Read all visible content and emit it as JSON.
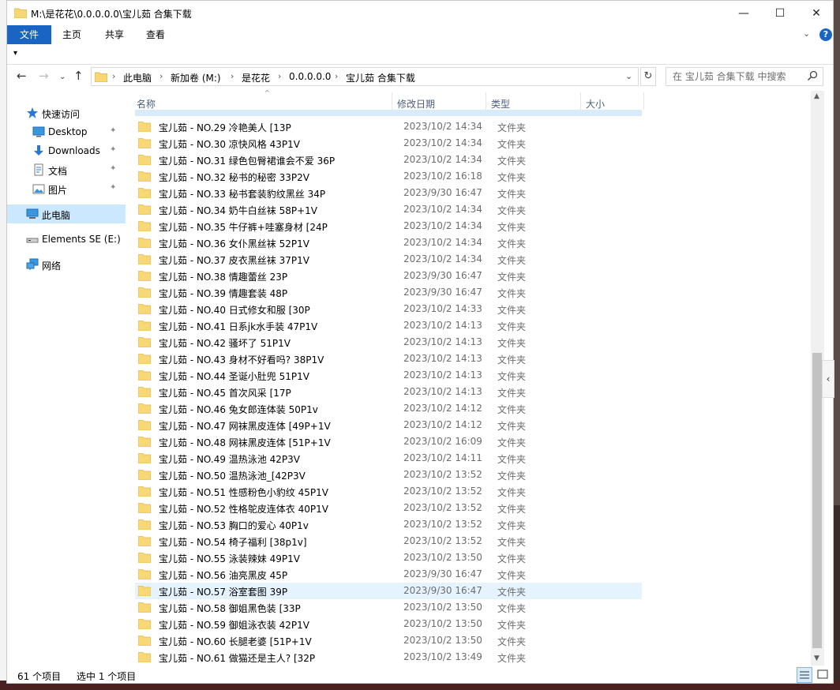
{
  "window": {
    "title": "M:\\是花花\\0.0.0.0.0\\宝儿茹 合集下载"
  },
  "controls": {
    "minimize": "—",
    "maximize": "☐",
    "close": "✕"
  },
  "ribbon": {
    "tabs": [
      "文件",
      "主页",
      "共享",
      "查看"
    ],
    "expand": "⌄",
    "help": "?"
  },
  "qat": {
    "arrow": "▾"
  },
  "nav": {
    "back": "←",
    "forward": "→",
    "recent": "⌄",
    "up": "↑"
  },
  "address": {
    "crumbs": [
      "此电脑",
      "新加卷 (M:)",
      "是花花",
      "0.0.0.0.0",
      "宝儿茹 合集下载"
    ],
    "separator": "›",
    "dropdown": "⌄",
    "refresh": "↻"
  },
  "search": {
    "placeholder": "在 宝儿茹 合集下载 中搜索",
    "icon": "search-icon"
  },
  "navpane": {
    "items": [
      {
        "label": "快速访问",
        "icon": "star-icon"
      },
      {
        "label": "Desktop",
        "icon": "desktop-icon",
        "pinned": true
      },
      {
        "label": "Downloads",
        "icon": "download-icon",
        "pinned": true
      },
      {
        "label": "文档",
        "icon": "document-icon",
        "pinned": true
      },
      {
        "label": "图片",
        "icon": "pictures-icon",
        "pinned": true
      },
      {
        "label": "此电脑",
        "icon": "computer-icon",
        "selected": true
      },
      {
        "label": "Elements SE (E:)",
        "icon": "drive-icon"
      },
      {
        "label": "网络",
        "icon": "network-icon"
      }
    ],
    "pin_glyph": "📌"
  },
  "columns": {
    "name": "名称",
    "date": "修改日期",
    "type": "类型",
    "size": "大小",
    "sort_glyph": "^"
  },
  "files": [
    {
      "name": "宝儿茹 - NO.29 冷艳美人 [13P",
      "date": "2023/10/2 14:34",
      "type": "文件夹"
    },
    {
      "name": "宝儿茹 - NO.30 凉快风格 43P1V",
      "date": "2023/10/2 14:34",
      "type": "文件夹"
    },
    {
      "name": "宝儿茹 - NO.31 绿色包臀裙谁会不爱 36P",
      "date": "2023/10/2 14:34",
      "type": "文件夹"
    },
    {
      "name": "宝儿茹 - NO.32 秘书的秘密 33P2V",
      "date": "2023/10/2 16:18",
      "type": "文件夹"
    },
    {
      "name": "宝儿茹 - NO.33 秘书套装豹纹黑丝 34P",
      "date": "2023/9/30 16:47",
      "type": "文件夹"
    },
    {
      "name": "宝儿茹 - NO.34 奶牛白丝袜 58P+1V",
      "date": "2023/10/2 14:34",
      "type": "文件夹"
    },
    {
      "name": "宝儿茹 - NO.35 牛仔裤+哇塞身材 [24P",
      "date": "2023/10/2 14:34",
      "type": "文件夹"
    },
    {
      "name": "宝儿茹 - NO.36 女仆黑丝袜 52P1V",
      "date": "2023/10/2 14:34",
      "type": "文件夹"
    },
    {
      "name": "宝儿茹 - NO.37 皮衣黑丝袜 37P1V",
      "date": "2023/10/2 14:34",
      "type": "文件夹"
    },
    {
      "name": "宝儿茹 - NO.38 情趣蕾丝 23P",
      "date": "2023/9/30 16:47",
      "type": "文件夹"
    },
    {
      "name": "宝儿茹 - NO.39 情趣套装 48P",
      "date": "2023/9/30 16:47",
      "type": "文件夹"
    },
    {
      "name": "宝儿茹 - NO.40 日式修女和服 [30P",
      "date": "2023/10/2 14:33",
      "type": "文件夹"
    },
    {
      "name": "宝儿茹 - NO.41 日系jk水手装 47P1V",
      "date": "2023/10/2 14:13",
      "type": "文件夹"
    },
    {
      "name": "宝儿茹 - NO.42 骚坏了 51P1V",
      "date": "2023/10/2 14:13",
      "type": "文件夹"
    },
    {
      "name": "宝儿茹 - NO.43 身材不好看吗? 38P1V",
      "date": "2023/10/2 14:13",
      "type": "文件夹"
    },
    {
      "name": "宝儿茹 - NO.44 圣诞小肚兜 51P1V",
      "date": "2023/10/2 14:13",
      "type": "文件夹"
    },
    {
      "name": "宝儿茹 - NO.45 首次风采 [17P",
      "date": "2023/10/2 14:13",
      "type": "文件夹"
    },
    {
      "name": "宝儿茹 - NO.46 兔女郎连体装 50P1v",
      "date": "2023/10/2 14:12",
      "type": "文件夹"
    },
    {
      "name": "宝儿茹 - NO.47 网袜黑皮连体 [49P+1V",
      "date": "2023/10/2 14:12",
      "type": "文件夹"
    },
    {
      "name": "宝儿茹 - NO.48 网袜黑皮连体 [51P+1V",
      "date": "2023/10/2 16:09",
      "type": "文件夹"
    },
    {
      "name": "宝儿茹 - NO.49 温热泳池 42P3V",
      "date": "2023/10/2 14:11",
      "type": "文件夹"
    },
    {
      "name": "宝儿茹 - NO.50 温热泳池_[42P3V",
      "date": "2023/10/2 13:52",
      "type": "文件夹"
    },
    {
      "name": "宝儿茹 - NO.51 性感粉色小豹纹 45P1V",
      "date": "2023/10/2 13:52",
      "type": "文件夹"
    },
    {
      "name": "宝儿茹 - NO.52 性格鸵皮连体衣 40P1V",
      "date": "2023/10/2 13:52",
      "type": "文件夹"
    },
    {
      "name": "宝儿茹 - NO.53 胸口的爱心 40P1v",
      "date": "2023/10/2 13:52",
      "type": "文件夹"
    },
    {
      "name": "宝儿茹 - NO.54 椅子福利 [38p1v]",
      "date": "2023/10/2 13:52",
      "type": "文件夹"
    },
    {
      "name": "宝儿茹 - NO.55 泳装辣妹 49P1V",
      "date": "2023/10/2 13:50",
      "type": "文件夹"
    },
    {
      "name": "宝儿茹 - NO.56 油亮黑皮 45P",
      "date": "2023/9/30 16:47",
      "type": "文件夹"
    },
    {
      "name": "宝儿茹 - NO.57 浴室套图 39P",
      "date": "2023/9/30 16:47",
      "type": "文件夹",
      "selected": true
    },
    {
      "name": "宝儿茹 - NO.58 御姐黑色装 [33P",
      "date": "2023/10/2 13:50",
      "type": "文件夹"
    },
    {
      "name": "宝儿茹 - NO.59 御姐泳衣装 42P1V",
      "date": "2023/10/2 13:50",
      "type": "文件夹"
    },
    {
      "name": "宝儿茹 - NO.60 长腿老婆 [51P+1V",
      "date": "2023/10/2 13:50",
      "type": "文件夹"
    },
    {
      "name": "宝儿茹 - NO.61 做猫还是主人? [32P",
      "date": "2023/10/2 13:49",
      "type": "文件夹"
    }
  ],
  "scroll": {
    "up": "▲",
    "down": "▼",
    "collapse": "‹"
  },
  "status": {
    "count": "61 个项目",
    "selection": "选中 1 个项目"
  },
  "colors": {
    "accent": "#1a64c4",
    "selected_row": "#e5f3ff",
    "nav_selected": "#cce8ff",
    "folder": "#f8d775"
  }
}
